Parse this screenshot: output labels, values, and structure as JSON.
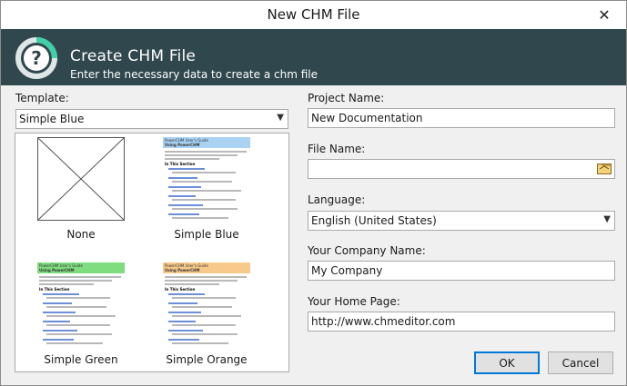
{
  "window": {
    "title": "New CHM File",
    "close_glyph": "✕"
  },
  "banner": {
    "heading": "Create CHM File",
    "subheading": "Enter the necessary data to create a chm file",
    "logo_icon": "help-question-icon",
    "color": "#30484d"
  },
  "template": {
    "label": "Template:",
    "selected": "Simple Blue",
    "items": [
      {
        "caption": "None"
      },
      {
        "caption": "Simple Blue",
        "accent": "#a9d2f3"
      },
      {
        "caption": "Simple Green",
        "accent": "#7fdc7f"
      },
      {
        "caption": "Simple Orange",
        "accent": "#f7c98a"
      }
    ],
    "preview_text": {
      "guide": "PowerCHM User's Guide",
      "using": "Using PowerCHM",
      "section": "In This Section"
    }
  },
  "project_name": {
    "label": "Project Name:",
    "value": "New Documentation"
  },
  "file_name": {
    "label": "File Name:",
    "value": "",
    "browse_icon": "folder-open-icon"
  },
  "language": {
    "label": "Language:",
    "selected": "English (United States)"
  },
  "company": {
    "label": "Your Company Name:",
    "value": "My Company"
  },
  "homepage": {
    "label": "Your Home Page:",
    "value": "http://www.chmeditor.com"
  },
  "buttons": {
    "ok": "OK",
    "cancel": "Cancel"
  }
}
